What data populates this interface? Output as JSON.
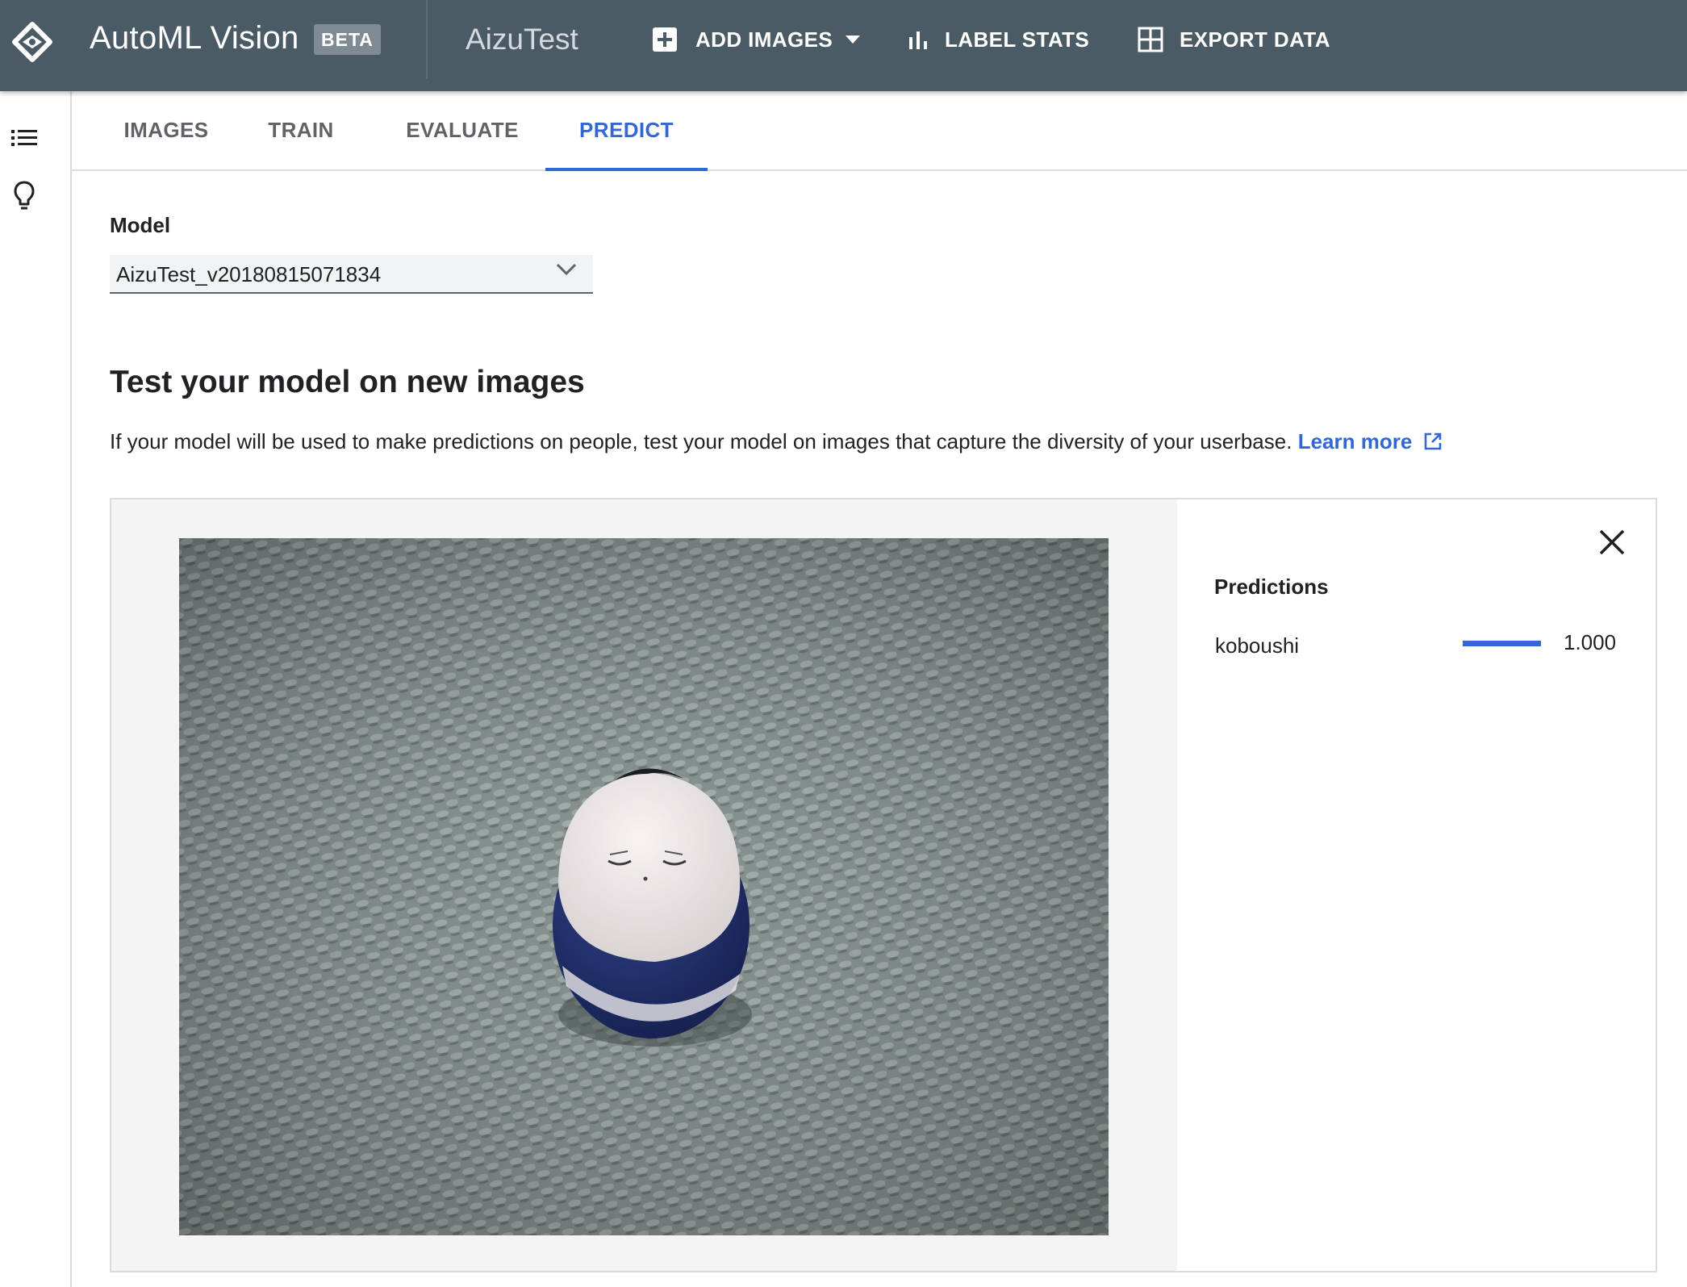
{
  "header": {
    "app_title": "AutoML Vision",
    "badge": "BETA",
    "project": "AizuTest",
    "add_images_label": "ADD IMAGES",
    "label_stats_label": "LABEL STATS",
    "export_data_label": "EXPORT DATA"
  },
  "tabs": [
    {
      "label": "IMAGES"
    },
    {
      "label": "TRAIN"
    },
    {
      "label": "EVALUATE"
    },
    {
      "label": "PREDICT",
      "active": true
    }
  ],
  "model": {
    "label": "Model",
    "selected": "AizuTest_v20180815071834"
  },
  "section": {
    "title": "Test your model on new images",
    "description": "If your model will be used to make predictions on people, test your model on images that capture the diversity of your userbase.",
    "learn_more": "Learn more"
  },
  "predictions": {
    "title": "Predictions",
    "items": [
      {
        "label": "koboushi",
        "score": "1.000",
        "fraction": 1.0
      }
    ]
  },
  "colors": {
    "topbar": "#4b5b66",
    "accent": "#3367d6"
  },
  "icons": [
    "automl-logo-icon",
    "add-box-icon",
    "dropdown-caret-icon",
    "bar-chart-icon",
    "grid-icon",
    "list-icon",
    "lightbulb-icon",
    "chevron-down-icon",
    "external-link-icon",
    "close-icon"
  ]
}
